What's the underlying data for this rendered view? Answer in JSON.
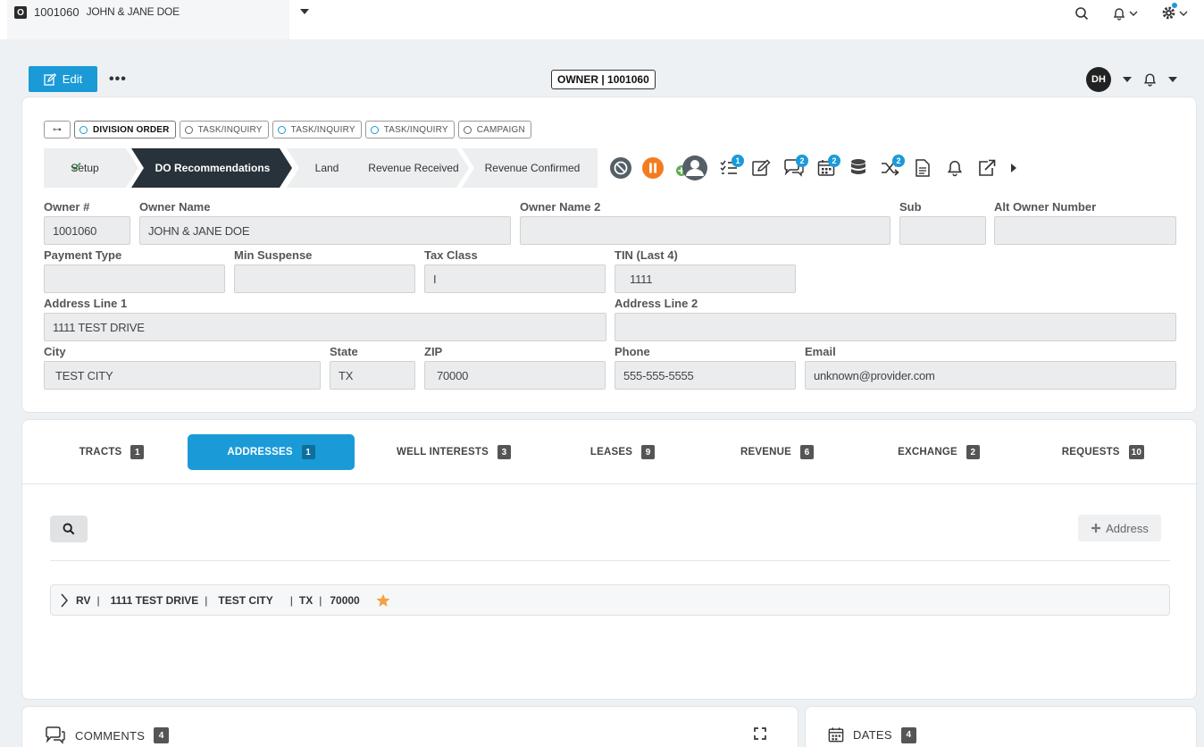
{
  "topbar": {
    "tab_icon": "O",
    "tab_number": "1001060",
    "tab_name": "JOHN & JANE DOE",
    "icons": [
      "search-icon",
      "bell-icon",
      "gear-icon"
    ]
  },
  "toolbar": {
    "edit_label": "Edit",
    "more_label": "•••",
    "owner_badge": "OWNER | 1001060",
    "avatar_initials": "DH"
  },
  "tags": {
    "first": "⊶",
    "items": [
      {
        "label": "DIVISION ORDER"
      },
      {
        "label": "TASK/INQUIRY"
      },
      {
        "label": "TASK/INQUIRY"
      },
      {
        "label": "TASK/INQUIRY"
      },
      {
        "label": "CAMPAIGN"
      }
    ]
  },
  "stages": [
    {
      "label": "Setup",
      "state": "done"
    },
    {
      "label": "DO Recommendations",
      "state": "current"
    },
    {
      "label": "Land",
      "state": "pending"
    },
    {
      "label": "Revenue Received",
      "state": "pending"
    },
    {
      "label": "Revenue Confirmed",
      "state": "pending"
    }
  ],
  "stage_icons": {
    "tasks_badge": "1",
    "comments_badge": "2",
    "calendar_badge": "2",
    "shuffle_badge": "2"
  },
  "form": {
    "owner_no": {
      "label": "Owner #",
      "value": "1001060"
    },
    "owner_name": {
      "label": "Owner Name",
      "value": "JOHN & JANE DOE"
    },
    "owner_name2": {
      "label": "Owner Name 2",
      "value": ""
    },
    "sub": {
      "label": "Sub",
      "value": ""
    },
    "alt_owner": {
      "label": "Alt Owner Number",
      "value": ""
    },
    "payment_type": {
      "label": "Payment Type",
      "value": ""
    },
    "min_suspense": {
      "label": "Min Suspense",
      "value": ""
    },
    "tax_class": {
      "label": "Tax Class",
      "value": "I"
    },
    "tin": {
      "label": "TIN (Last 4)",
      "value": "1111"
    },
    "address1": {
      "label": "Address Line 1",
      "value": "1111 TEST DRIVE"
    },
    "address2": {
      "label": "Address Line 2",
      "value": ""
    },
    "city": {
      "label": "City",
      "value": "TEST CITY"
    },
    "state": {
      "label": "State",
      "value": "TX"
    },
    "zip": {
      "label": "ZIP",
      "value": "70000"
    },
    "phone": {
      "label": "Phone",
      "value": "555-555-5555"
    },
    "email": {
      "label": "Email",
      "value": "unknown@provider.com"
    }
  },
  "tabs": [
    {
      "label": "TRACTS",
      "count": "1"
    },
    {
      "label": "ADDRESSES",
      "count": "1"
    },
    {
      "label": "WELL INTERESTS",
      "count": "3"
    },
    {
      "label": "LEASES",
      "count": "9"
    },
    {
      "label": "REVENUE",
      "count": "6"
    },
    {
      "label": "EXCHANGE",
      "count": "2"
    },
    {
      "label": "REQUESTS",
      "count": "10"
    }
  ],
  "addresses": {
    "add_label": "Address",
    "row": {
      "type": "RV",
      "street": "1111 TEST DRIVE",
      "city": "TEST CITY",
      "state": "TX",
      "zip": "70000"
    }
  },
  "comments": {
    "title": "COMMENTS",
    "count": "4"
  },
  "dates": {
    "title": "DATES",
    "count": "4"
  },
  "colors": {
    "accent": "#1a9bd7",
    "stage_current": "#27323a",
    "cancel": "#555f66",
    "pause": "#f47c20",
    "star": "#f5a142"
  }
}
